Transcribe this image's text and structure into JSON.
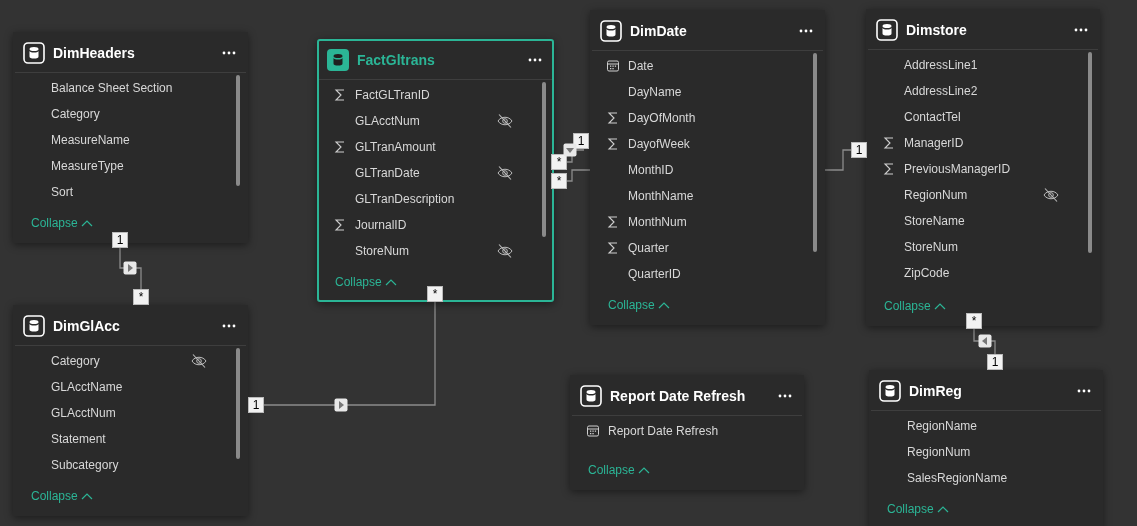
{
  "tables": [
    {
      "name": "DimHeaders",
      "selected": false,
      "fields": [
        {
          "name": "Balance Sheet Section",
          "kind": "text",
          "hidden": false
        },
        {
          "name": "Category",
          "kind": "text",
          "hidden": false
        },
        {
          "name": "MeasureName",
          "kind": "text",
          "hidden": false
        },
        {
          "name": "MeasureType",
          "kind": "text",
          "hidden": false
        },
        {
          "name": "Sort",
          "kind": "text",
          "hidden": false
        }
      ],
      "collapse": "Collapse"
    },
    {
      "name": "FactGltrans",
      "selected": true,
      "fields": [
        {
          "name": "FactGLTranID",
          "kind": "sum",
          "hidden": false
        },
        {
          "name": "GLAcctNum",
          "kind": "text",
          "hidden": true
        },
        {
          "name": "GLTranAmount",
          "kind": "sum",
          "hidden": false
        },
        {
          "name": "GLTranDate",
          "kind": "text",
          "hidden": true
        },
        {
          "name": "GLTranDescription",
          "kind": "text",
          "hidden": false
        },
        {
          "name": "JournalID",
          "kind": "sum",
          "hidden": false
        },
        {
          "name": "StoreNum",
          "kind": "text",
          "hidden": true
        }
      ],
      "collapse": "Collapse"
    },
    {
      "name": "DimDate",
      "selected": false,
      "fields": [
        {
          "name": "Date",
          "kind": "date",
          "hidden": false
        },
        {
          "name": "DayName",
          "kind": "text",
          "hidden": false
        },
        {
          "name": "DayOfMonth",
          "kind": "sum",
          "hidden": false
        },
        {
          "name": "DayofWeek",
          "kind": "sum",
          "hidden": false
        },
        {
          "name": "MonthID",
          "kind": "text",
          "hidden": false
        },
        {
          "name": "MonthName",
          "kind": "text",
          "hidden": false
        },
        {
          "name": "MonthNum",
          "kind": "sum",
          "hidden": false
        },
        {
          "name": "Quarter",
          "kind": "sum",
          "hidden": false
        },
        {
          "name": "QuarterID",
          "kind": "text",
          "hidden": false
        }
      ],
      "collapse": "Collapse"
    },
    {
      "name": "Dimstore",
      "selected": false,
      "fields": [
        {
          "name": "AddressLine1",
          "kind": "text",
          "hidden": false
        },
        {
          "name": "AddressLine2",
          "kind": "text",
          "hidden": false
        },
        {
          "name": "ContactTel",
          "kind": "text",
          "hidden": false
        },
        {
          "name": "ManagerID",
          "kind": "sum",
          "hidden": false
        },
        {
          "name": "PreviousManagerID",
          "kind": "sum",
          "hidden": false
        },
        {
          "name": "RegionNum",
          "kind": "text",
          "hidden": true
        },
        {
          "name": "StoreName",
          "kind": "text",
          "hidden": false
        },
        {
          "name": "StoreNum",
          "kind": "text",
          "hidden": false
        },
        {
          "name": "ZipCode",
          "kind": "text",
          "hidden": false
        }
      ],
      "collapse": "Collapse"
    },
    {
      "name": "DimGlAcc",
      "selected": false,
      "fields": [
        {
          "name": "Category",
          "kind": "text",
          "hidden": true
        },
        {
          "name": "GLAcctName",
          "kind": "text",
          "hidden": false
        },
        {
          "name": "GLAcctNum",
          "kind": "text",
          "hidden": false
        },
        {
          "name": "Statement",
          "kind": "text",
          "hidden": false
        },
        {
          "name": "Subcategory",
          "kind": "text",
          "hidden": false
        }
      ],
      "collapse": "Collapse"
    },
    {
      "name": "Report Date Refresh",
      "selected": false,
      "fields": [
        {
          "name": "Report Date Refresh",
          "kind": "date",
          "hidden": false
        }
      ],
      "collapse": "Collapse"
    },
    {
      "name": "DimReg",
      "selected": false,
      "fields": [
        {
          "name": "RegionName",
          "kind": "text",
          "hidden": false
        },
        {
          "name": "RegionNum",
          "kind": "text",
          "hidden": false
        },
        {
          "name": "SalesRegionName",
          "kind": "text",
          "hidden": false
        }
      ],
      "collapse": "Collapse"
    }
  ],
  "relationships": [
    {
      "labels": [
        "1",
        "*"
      ]
    },
    {
      "labels": [
        "1",
        "*"
      ]
    },
    {
      "labels": [
        "1",
        "*",
        "*"
      ]
    },
    {
      "labels": [
        "1"
      ]
    },
    {
      "labels": [
        "*",
        "1"
      ]
    }
  ]
}
